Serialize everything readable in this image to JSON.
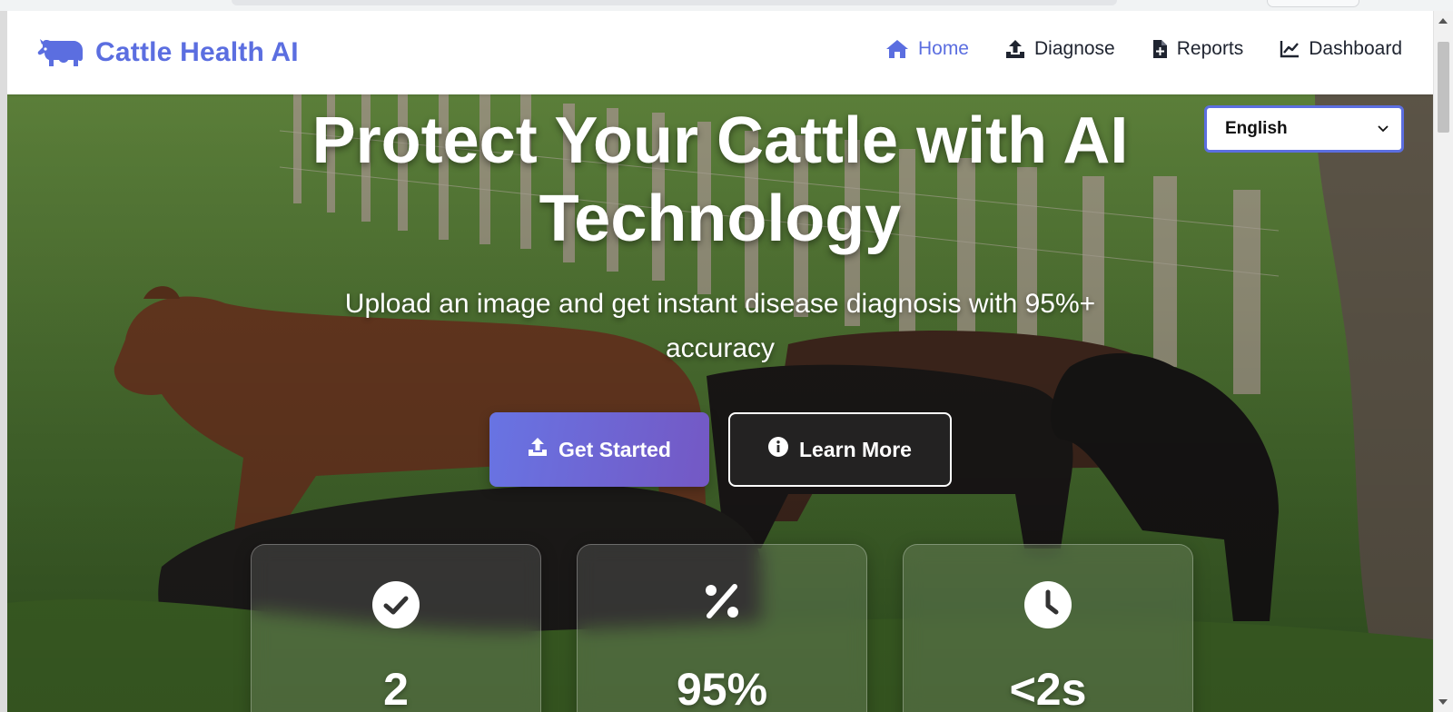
{
  "brand": {
    "name": "Cattle Health AI",
    "icon": "cow-icon",
    "color": "#5b6ee0"
  },
  "nav": {
    "items": [
      {
        "label": "Home",
        "icon": "home-icon",
        "active": true
      },
      {
        "label": "Diagnose",
        "icon": "upload-icon",
        "active": false
      },
      {
        "label": "Reports",
        "icon": "file-plus-icon",
        "active": false
      },
      {
        "label": "Dashboard",
        "icon": "line-chart-icon",
        "active": false
      }
    ]
  },
  "language": {
    "selected": "English"
  },
  "hero": {
    "title_line1": "Protect Your Cattle with AI",
    "title_line2": "Technology",
    "subtitle_line1": "Upload an image and get instant disease diagnosis with 95%+",
    "subtitle_line2": "accuracy",
    "primary_button": "Get Started",
    "secondary_button": "Learn More"
  },
  "stats": [
    {
      "icon": "check-circle-icon",
      "value": "2"
    },
    {
      "icon": "percent-icon",
      "value": "95%"
    },
    {
      "icon": "clock-icon",
      "value": "<2s"
    }
  ],
  "colors": {
    "accent": "#5b6ee0",
    "button_gradient_start": "#6874e3",
    "button_gradient_end": "#7458c4"
  }
}
